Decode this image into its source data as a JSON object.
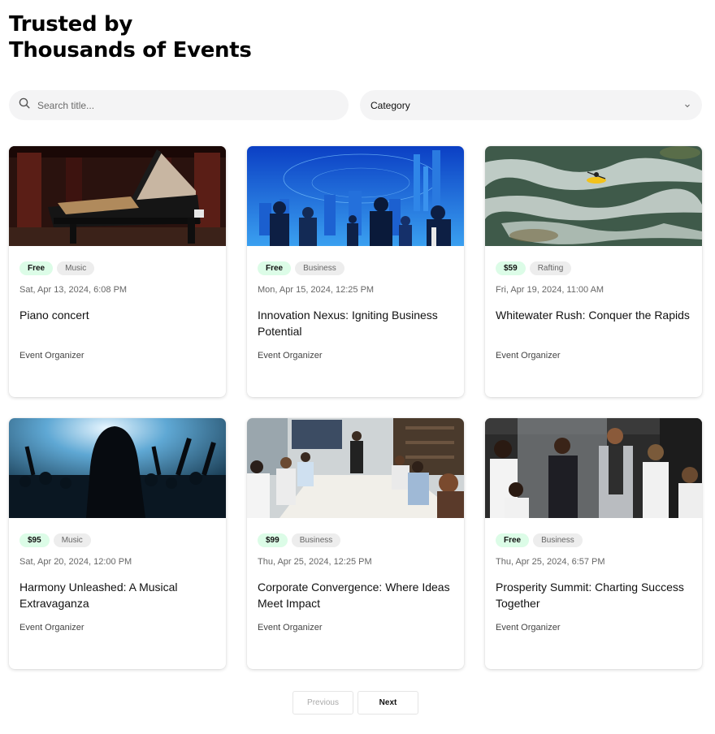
{
  "header": {
    "title_line1": "Trusted by",
    "title_line2": "Thousands of Events"
  },
  "search": {
    "placeholder": "Search title..."
  },
  "category_select": {
    "label": "Category"
  },
  "events": [
    {
      "price": "Free",
      "category": "Music",
      "date": "Sat, Apr 13, 2024, 6:08 PM",
      "title": "Piano concert",
      "organizer": "Event Organizer"
    },
    {
      "price": "Free",
      "category": "Business",
      "date": "Mon, Apr 15, 2024, 12:25 PM",
      "title": "Innovation Nexus: Igniting Business Potential",
      "organizer": "Event Organizer"
    },
    {
      "price": "$59",
      "category": "Rafting",
      "date": "Fri, Apr 19, 2024, 11:00 AM",
      "title": "Whitewater Rush: Conquer the Rapids",
      "organizer": "Event Organizer"
    },
    {
      "price": "$95",
      "category": "Music",
      "date": "Sat, Apr 20, 2024, 12:00 PM",
      "title": "Harmony Unleashed: A Musical Extravaganza",
      "organizer": "Event Organizer"
    },
    {
      "price": "$99",
      "category": "Business",
      "date": "Thu, Apr 25, 2024, 12:25 PM",
      "title": "Corporate Convergence: Where Ideas Meet Impact",
      "organizer": "Event Organizer"
    },
    {
      "price": "Free",
      "category": "Business",
      "date": "Thu, Apr 25, 2024, 6:57 PM",
      "title": "Prosperity Summit: Charting Success Together",
      "organizer": "Event Organizer"
    }
  ],
  "pagination": {
    "previous_label": "Previous",
    "next_label": "Next"
  },
  "colors": {
    "price_badge_bg": "#dcfce7",
    "category_badge_bg": "#ededed",
    "input_bg": "#f4f4f5"
  }
}
